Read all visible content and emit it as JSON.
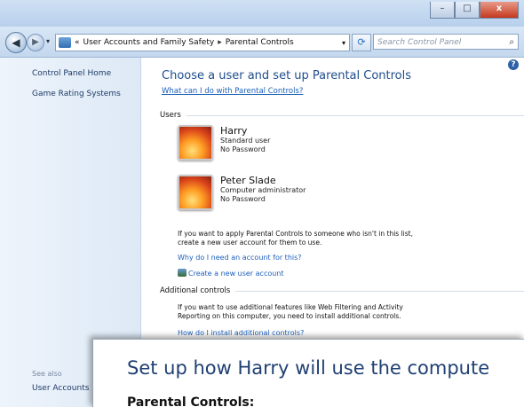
{
  "window_buttons": {
    "minimize": "–",
    "maximize": "□",
    "close": "x"
  },
  "address": {
    "breadcrumbs": [
      "User Accounts and Family Safety",
      "Parental Controls"
    ],
    "search_placeholder": "Search Control Panel"
  },
  "sidebar": {
    "items": [
      "Control Panel Home",
      "Game Rating Systems"
    ],
    "see_also": "See also",
    "see_also_items": [
      "User Accounts"
    ]
  },
  "main": {
    "title": "Choose a user and set up Parental Controls",
    "what_link": "What can I do with Parental Controls?",
    "users_label": "Users",
    "users": [
      {
        "name": "Harry",
        "type": "Standard user",
        "password": "No Password"
      },
      {
        "name": "Peter Slade",
        "type": "Computer administrator",
        "password": "No Password"
      }
    ],
    "apply_text_1": "If you want to apply Parental Controls to someone who isn't in this list,",
    "apply_text_2": "create a new user account for them to use.",
    "why_link": "Why do I need an account for this?",
    "create_link": "Create a new user account",
    "additional_label": "Additional controls",
    "additional_text_1": "If you want to use additional features like Web Filtering and Activity",
    "additional_text_2": "Reporting on this computer, you need to install additional controls.",
    "install_link": "How do I install additional controls?"
  },
  "overlay": {
    "title": "Set up how Harry will use the compute",
    "subtitle": "Parental Controls:"
  }
}
